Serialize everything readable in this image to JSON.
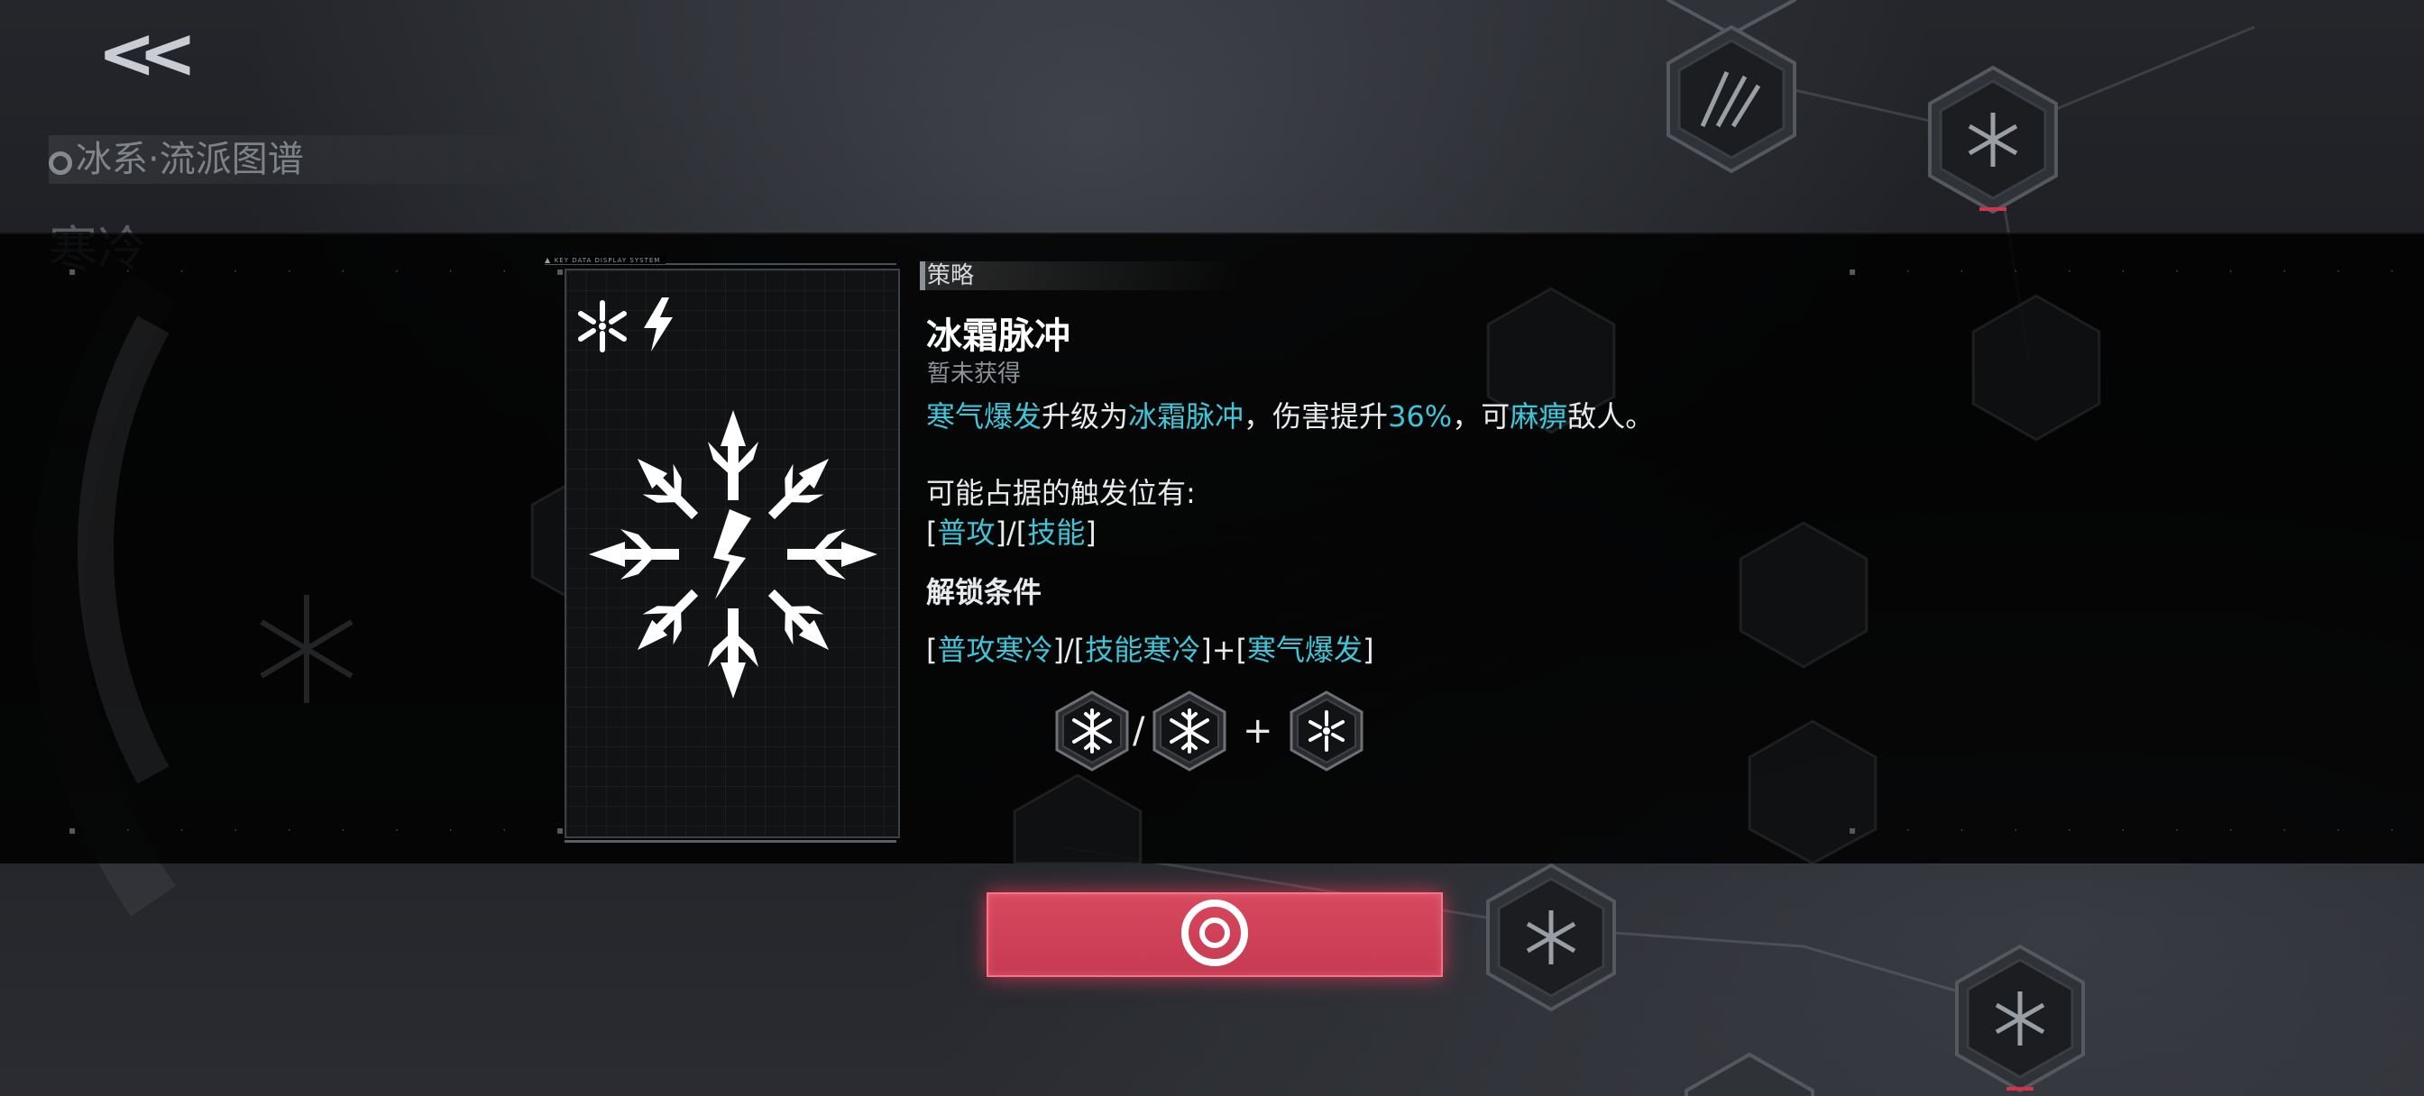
{
  "header": {
    "back_label": "<<",
    "school_title": "冰系·流派图谱",
    "school_subtitle": "寒冷"
  },
  "card": {
    "caption": "KEY DATA DISPLAY SYSTEM",
    "tag_icons": [
      "ice-burst-icon",
      "lightning-icon"
    ],
    "main_icon": "frost-snowflake-icon"
  },
  "skill": {
    "category": "策略",
    "name": "冰霜脉冲",
    "status": "暂未获得",
    "description": {
      "source_skill": "寒气爆发",
      "text1": "升级为",
      "target_skill": "冰霜脉冲",
      "text2": "，伤害提升",
      "value": "36%",
      "text3": "，可",
      "effect": "麻痹",
      "text4": "敌人。"
    },
    "trigger_label": "可能占据的触发位有:",
    "triggers": [
      "普攻",
      "技能"
    ],
    "unlock_label": "解锁条件",
    "unlock": {
      "a": "普攻寒冷",
      "b": "技能寒冷",
      "c": "寒气爆发"
    },
    "requirement_icons": [
      "snowflake-icon",
      "snowflake-icon",
      "ice-burst-icon"
    ],
    "requirement_separators": [
      "/",
      "+"
    ]
  },
  "colors": {
    "accent_cyan": "#3ec6d8",
    "confirm_red": "#d7485e",
    "panel_black": "#000000"
  },
  "confirm_button": {
    "icon": "target-ring-icon"
  }
}
